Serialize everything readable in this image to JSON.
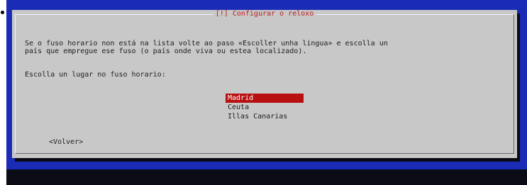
{
  "dialog": {
    "title": "[!] Configurar o reloxo",
    "message_line1": "Se o fuso horario non está na lista volte ao paso «Escoller unha lingua» e escolla un",
    "message_line2": "país que empregue ese fuso (o país onde viva ou estea localizado).",
    "prompt": "Escolla un lugar no fuso horario:",
    "options": [
      {
        "label": "Madrid",
        "selected": true
      },
      {
        "label": "Ceuta",
        "selected": false
      },
      {
        "label": "Illas Canarias",
        "selected": false
      }
    ],
    "back_button": "<Volver>"
  },
  "colors": {
    "screen_background": "#1a2bb5",
    "dialog_background": "#c8c8c8",
    "title_color": "#c02020",
    "selection_background": "#b81010",
    "selection_text": "#ffffff"
  }
}
